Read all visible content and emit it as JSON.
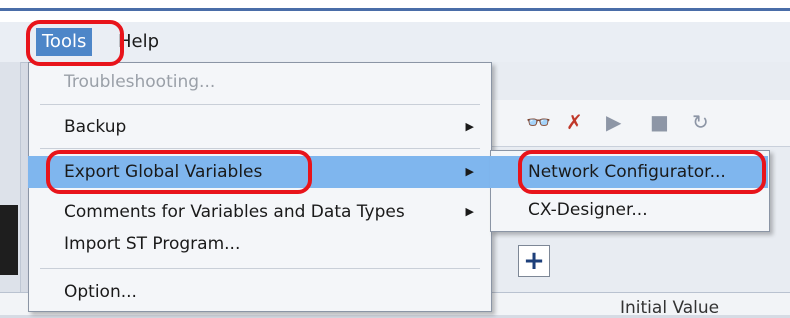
{
  "menubar": {
    "tools": "Tools",
    "help": "Help"
  },
  "tools_menu": {
    "items": [
      {
        "label": "Troubleshooting...",
        "disabled": true,
        "submenu": false
      },
      {
        "label": "Backup",
        "disabled": false,
        "submenu": true
      },
      {
        "label": "Export Global Variables",
        "disabled": false,
        "submenu": true,
        "highlighted": true
      },
      {
        "label": "Comments for Variables and Data Types",
        "disabled": false,
        "submenu": true
      },
      {
        "label": "Import ST Program...",
        "disabled": false,
        "submenu": false
      },
      {
        "label": "Option...",
        "disabled": false,
        "submenu": false
      }
    ]
  },
  "submenu": {
    "items": [
      {
        "label": "Network Configurator...",
        "highlighted": true
      },
      {
        "label": "CX-Designer..."
      }
    ]
  },
  "toolbar": {
    "add_label": "+"
  },
  "grid": {
    "col_initial_value": "Initial Value"
  },
  "colors": {
    "highlight": "#7fb6ee",
    "callout": "#e8141b",
    "menu_active": "#4d86c8"
  },
  "icons": [
    "watch-icon",
    "delete-watch-icon",
    "step-in-icon",
    "step-out-icon",
    "refresh-icon",
    "submenu-arrow-icon"
  ]
}
